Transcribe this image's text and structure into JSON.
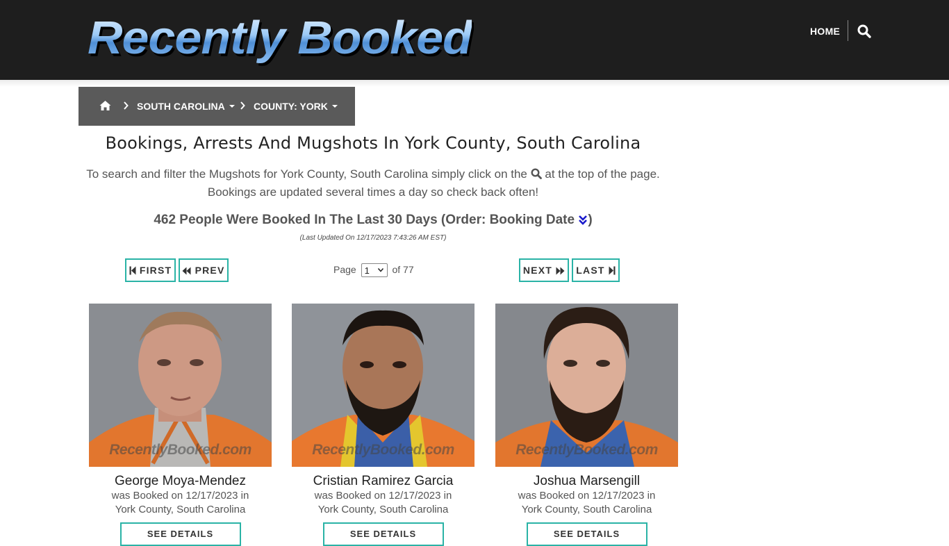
{
  "header": {
    "logo_text": "Recently Booked",
    "nav_home": "HOME",
    "search_icon": "search-icon"
  },
  "breadcrumb": {
    "home_icon": "home-icon",
    "state": "SOUTH CAROLINA",
    "county": "COUNTY: YORK"
  },
  "main": {
    "title": "Bookings, Arrests And Mugshots In York County, South Carolina",
    "intro_part1": "To search and filter the Mugshots for York County, South Carolina simply click on the",
    "intro_part2": "at the top of the page.",
    "intro_line2": "Bookings are updated several times a day so check back often!",
    "count_text": "462 People Were Booked In The Last 30 Days (Order: Booking Date",
    "count_close": ")",
    "updated": "(Last Updated On 12/17/2023 7:43:26 AM EST)"
  },
  "pager": {
    "first": "FIRST",
    "prev": "PREV",
    "page_label": "Page",
    "page_value": "1",
    "of_label": "of 77",
    "next": "NEXT",
    "last": "LAST"
  },
  "bookings": [
    {
      "name": "George Moya-Mendez",
      "line1": "was Booked on 12/17/2023 in",
      "line2": "York County, South Carolina",
      "watermark": "RecentlyBooked.com",
      "button": "SEE DETAILS"
    },
    {
      "name": "Cristian Ramirez Garcia",
      "line1": "was Booked on 12/17/2023 in",
      "line2": "York County, South Carolina",
      "watermark": "RecentlyBooked.com",
      "button": "SEE DETAILS"
    },
    {
      "name": "Joshua Marsengill",
      "line1": "was Booked on 12/17/2023 in",
      "line2": "York County, South Carolina",
      "watermark": "RecentlyBooked.com",
      "button": "SEE DETAILS"
    }
  ]
}
